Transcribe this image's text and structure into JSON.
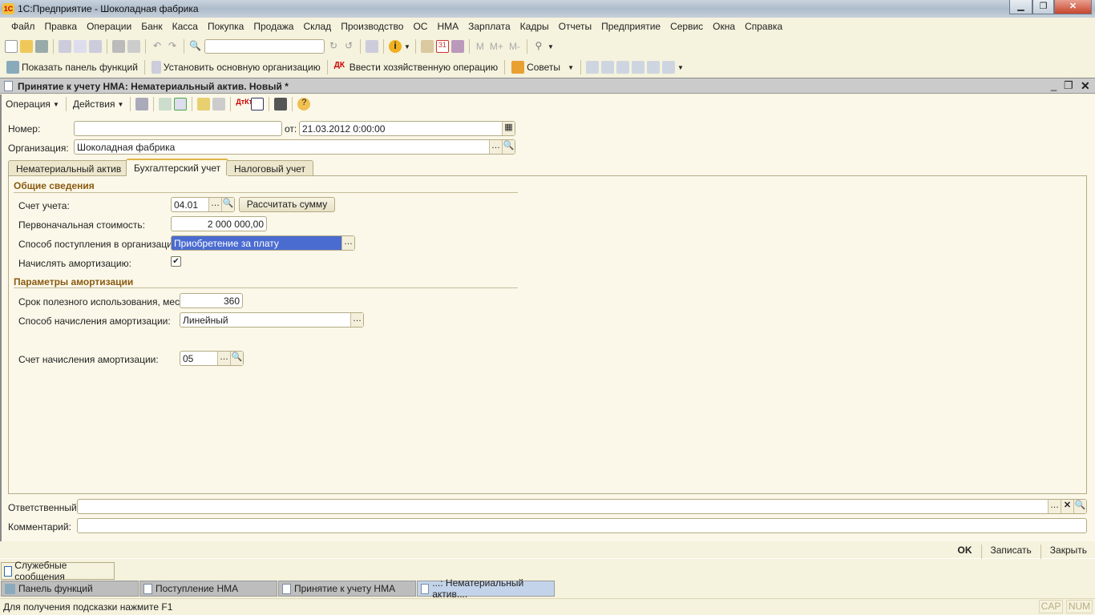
{
  "window": {
    "title": "1С:Предприятие - Шоколадная фабрика",
    "logo": "1С"
  },
  "menu": [
    "Файл",
    "Правка",
    "Операции",
    "Банк",
    "Касса",
    "Покупка",
    "Продажа",
    "Склад",
    "Производство",
    "ОС",
    "НМА",
    "Зарплата",
    "Кадры",
    "Отчеты",
    "Предприятие",
    "Сервис",
    "Окна",
    "Справка"
  ],
  "toolbar2": {
    "show_panel": "Показать панель функций",
    "set_org": "Установить основную организацию",
    "enter_op": "Ввести хозяйственную операцию",
    "tips": "Советы",
    "calc_m": "M",
    "calc_mplus": "M+",
    "calc_mminus": "M-"
  },
  "document": {
    "title": "Принятие к учету НМА: Нематериальный актив. Новый *",
    "operation": "Операция",
    "actions": "Действия",
    "number_label": "Номер:",
    "number_value": "",
    "date_label": "от:",
    "date_value": "21.03.2012  0:00:00",
    "org_label": "Организация:",
    "org_value": "Шоколадная фабрика",
    "tabs": [
      "Нематериальный актив",
      "Бухгалтерский учет",
      "Налоговый учет"
    ],
    "general": {
      "title": "Общие сведения",
      "account_label": "Счет учета:",
      "account_value": "04.01",
      "calc_button": "Рассчитать сумму",
      "cost_label": "Первоначальная стоимость:",
      "cost_value": "2 000 000,00",
      "method_label": "Способ поступления в организацию:",
      "method_value": "Приобретение за плату",
      "amort_label": "Начислять амортизацию:",
      "amort_checked": true
    },
    "amort": {
      "title": "Параметры амортизации",
      "term_label": "Срок полезного использования, мес.:",
      "term_value": "360",
      "method_label": "Способ начисления амортизации:",
      "method_value": "Линейный",
      "account_label": "Счет начисления амортизации:",
      "account_value": "05"
    },
    "responsible_label": "Ответственный:",
    "responsible_value": "",
    "comment_label": "Комментарий:",
    "comment_value": "",
    "ok": "OK",
    "save": "Записать",
    "close": "Закрыть"
  },
  "service_messages": "Служебные сообщения",
  "taskbar": [
    "Панель функций",
    "Поступление НМА",
    "Принятие к учету НМА",
    "...: Нематериальный актив...."
  ],
  "status": {
    "hint": "Для получения подсказки нажмите F1",
    "cap": "CAP",
    "num": "NUM"
  }
}
